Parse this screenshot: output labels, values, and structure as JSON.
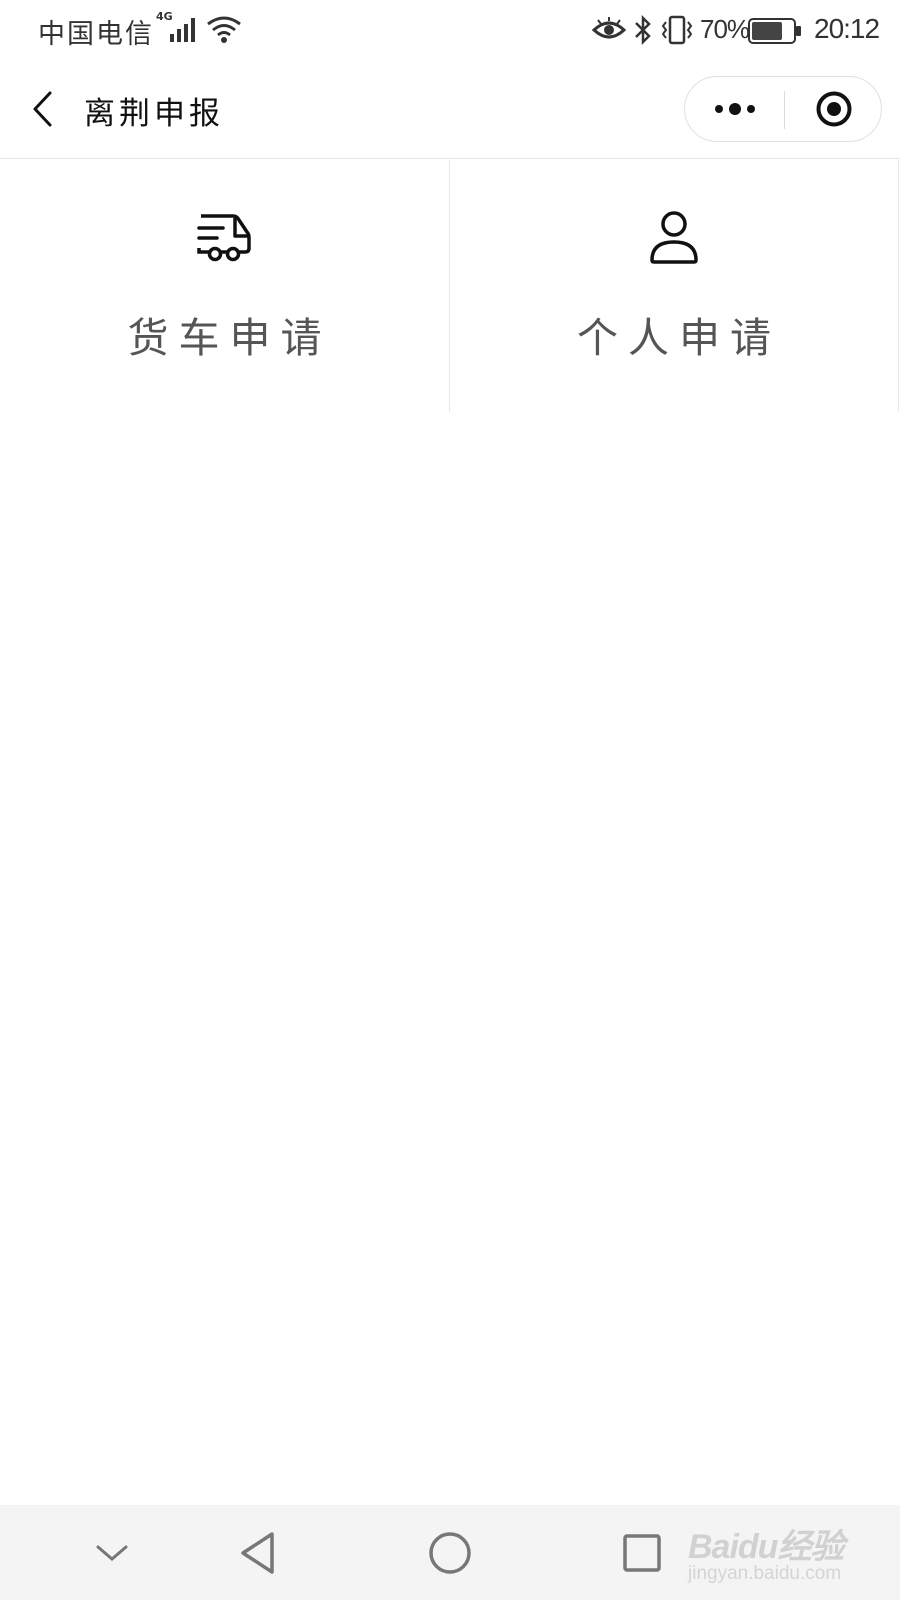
{
  "status_bar": {
    "carrier": "中国电信",
    "network_type": "4G",
    "battery_percent": "70%",
    "time": "20:12",
    "icons": [
      "signal-icon",
      "wifi-icon",
      "eye-comfort-icon",
      "bluetooth-icon",
      "vibrate-icon",
      "battery-icon"
    ]
  },
  "nav": {
    "title": "离荆申报",
    "back_icon": "chevron-left-icon",
    "capsule": {
      "more_icon": "more-dots-icon",
      "close_icon": "target-close-icon"
    }
  },
  "grid": {
    "items": [
      {
        "label": "货车申请",
        "icon": "truck-icon"
      },
      {
        "label": "个人申请",
        "icon": "person-icon"
      }
    ]
  },
  "android_nav": {
    "buttons": [
      "hide-keyboard-icon",
      "back-triangle-icon",
      "home-circle-icon",
      "recents-square-icon"
    ]
  },
  "watermark": {
    "logo": "Baidu经验",
    "sub": "jingyan.baidu.com"
  },
  "colors": {
    "background": "#ffffff",
    "text": "#1a1a1a",
    "label": "#555555",
    "divider": "#e8e8e8",
    "android_nav": "#f4f4f4"
  }
}
